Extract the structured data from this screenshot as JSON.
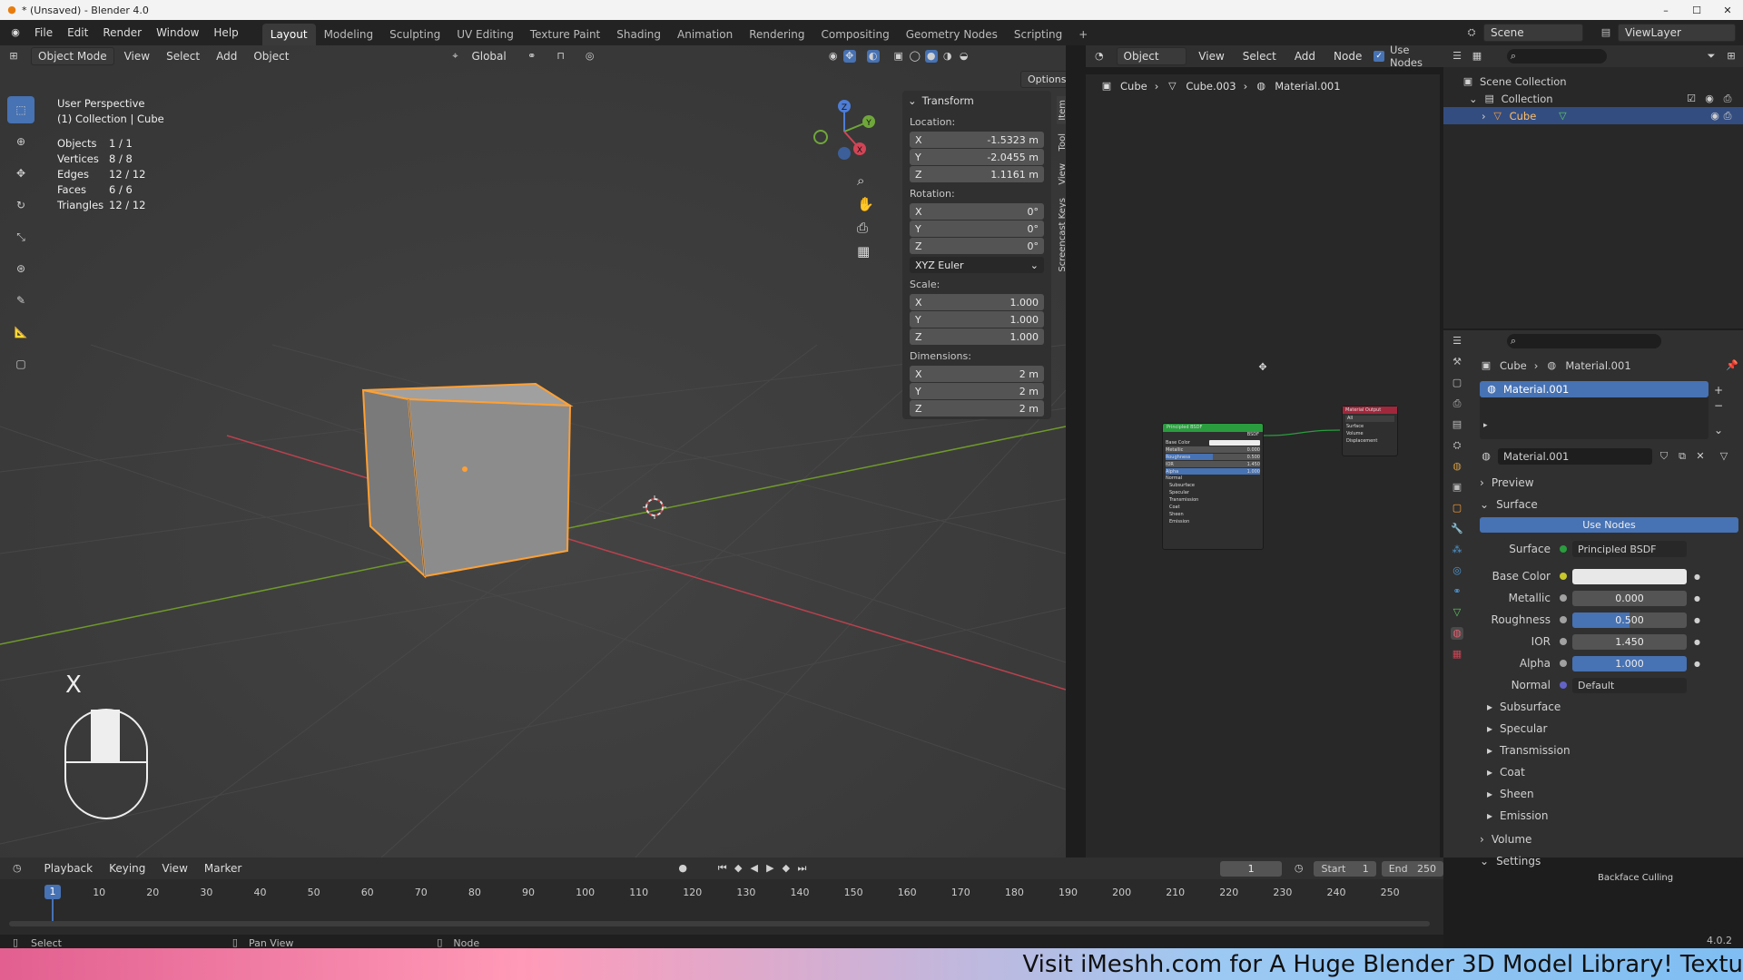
{
  "titlebar": {
    "title": "* (Unsaved) - Blender 4.0",
    "min": "–",
    "max": "☐",
    "close": "✕"
  },
  "menus": [
    "File",
    "Edit",
    "Render",
    "Window",
    "Help"
  ],
  "workspaces": [
    "Layout",
    "Modeling",
    "Sculpting",
    "UV Editing",
    "Texture Paint",
    "Shading",
    "Animation",
    "Rendering",
    "Compositing",
    "Geometry Nodes",
    "Scripting"
  ],
  "add_workspace": "+",
  "scene": {
    "name": "Scene",
    "view_layer": "ViewLayer"
  },
  "viewport": {
    "mode": "Object Mode",
    "menus": [
      "View",
      "Select",
      "Add",
      "Object"
    ],
    "orientation": "Global",
    "options": "Options",
    "overlay_title": "User Perspective",
    "overlay_sub": "(1) Collection | Cube",
    "stats": [
      {
        "k": "Objects",
        "v": "1 / 1"
      },
      {
        "k": "Vertices",
        "v": "8 / 8"
      },
      {
        "k": "Edges",
        "v": "12 / 12"
      },
      {
        "k": "Faces",
        "v": "6 / 6"
      },
      {
        "k": "Triangles",
        "v": "12 / 12"
      }
    ],
    "key_hint": "X",
    "gizmo": {
      "x": "X",
      "y": "Y",
      "z": "Z"
    },
    "side_tabs": [
      "Item",
      "Tool",
      "View",
      "Screencast Keys"
    ]
  },
  "npanel": {
    "section": "Transform",
    "location_label": "Location:",
    "location": [
      {
        "a": "X",
        "v": "-1.5323 m"
      },
      {
        "a": "Y",
        "v": "-2.0455 m"
      },
      {
        "a": "Z",
        "v": "1.1161 m"
      }
    ],
    "rotation_label": "Rotation:",
    "rotation": [
      {
        "a": "X",
        "v": "0°"
      },
      {
        "a": "Y",
        "v": "0°"
      },
      {
        "a": "Z",
        "v": "0°"
      }
    ],
    "rotation_mode": "XYZ Euler",
    "scale_label": "Scale:",
    "scale": [
      {
        "a": "X",
        "v": "1.000"
      },
      {
        "a": "Y",
        "v": "1.000"
      },
      {
        "a": "Z",
        "v": "1.000"
      }
    ],
    "dimensions_label": "Dimensions:",
    "dimensions": [
      {
        "a": "X",
        "v": "2 m"
      },
      {
        "a": "Y",
        "v": "2 m"
      },
      {
        "a": "Z",
        "v": "2 m"
      }
    ]
  },
  "node_editor": {
    "mode": "Object",
    "menus": [
      "View",
      "Select",
      "Add",
      "Node"
    ],
    "use_nodes": "Use Nodes",
    "breadcrumb": [
      "Cube",
      "Cube.003",
      "Material.001"
    ],
    "bsdf_title": "Principled BSDF",
    "bsdf_out": "BSDF",
    "bsdf_rows": [
      {
        "k": "Base Color",
        "v": ""
      },
      {
        "k": "Metallic",
        "v": "0.000"
      },
      {
        "k": "Roughness",
        "v": "0.500"
      },
      {
        "k": "IOR",
        "v": "1.450"
      },
      {
        "k": "Alpha",
        "v": "1.000"
      },
      {
        "k": "Normal",
        "v": ""
      },
      {
        "k": "Subsurface",
        "v": ""
      },
      {
        "k": "Specular",
        "v": ""
      },
      {
        "k": "Transmission",
        "v": ""
      },
      {
        "k": "Coat",
        "v": ""
      },
      {
        "k": "Sheen",
        "v": ""
      },
      {
        "k": "Emission",
        "v": ""
      }
    ],
    "output_title": "Material Output",
    "output_rows": [
      "All",
      "Surface",
      "Volume",
      "Displacement"
    ]
  },
  "outliner": {
    "root": "Scene Collection",
    "collection": "Collection",
    "object": "Cube"
  },
  "properties": {
    "breadcrumb": [
      "Cube",
      "Material.001"
    ],
    "slot": "Material.001",
    "material": "Material.001",
    "panels": {
      "preview": "Preview",
      "surface": "Surface",
      "volume": "Volume",
      "settings": "Settings",
      "backface": "Backface Culling"
    },
    "use_nodes": "Use Nodes",
    "surface_label": "Surface",
    "surface_value": "Principled BSDF",
    "fields": [
      {
        "k": "Base Color",
        "v": "",
        "type": "color"
      },
      {
        "k": "Metallic",
        "v": "0.000",
        "fill": 0
      },
      {
        "k": "Roughness",
        "v": "0.500",
        "fill": 0.5
      },
      {
        "k": "IOR",
        "v": "1.450",
        "fill": 0
      },
      {
        "k": "Alpha",
        "v": "1.000",
        "fill": 1
      },
      {
        "k": "Normal",
        "v": "Default",
        "type": "text"
      }
    ],
    "subpanels": [
      "Subsurface",
      "Specular",
      "Transmission",
      "Coat",
      "Sheen",
      "Emission"
    ]
  },
  "timeline": {
    "menus": [
      "Playback",
      "Keying",
      "View",
      "Marker"
    ],
    "frame": "1",
    "start_label": "Start",
    "start": "1",
    "end_label": "End",
    "end": "250",
    "ticks": [
      "1",
      "10",
      "20",
      "30",
      "40",
      "50",
      "60",
      "70",
      "80",
      "90",
      "100",
      "110",
      "120",
      "130",
      "140",
      "150",
      "160",
      "170",
      "180",
      "190",
      "200",
      "210",
      "220",
      "230",
      "240",
      "250"
    ]
  },
  "status": {
    "select": "Select",
    "pan": "Pan View",
    "node": "Node",
    "version": "4.0.2"
  },
  "ad": "Visit iMeshh.com for A Huge Blender 3D Model Library! Textu",
  "colors": {
    "accent": "#4772b3",
    "select_orange": "#ffa034",
    "node_green": "#2a9d3f",
    "node_red": "#a0283c"
  }
}
